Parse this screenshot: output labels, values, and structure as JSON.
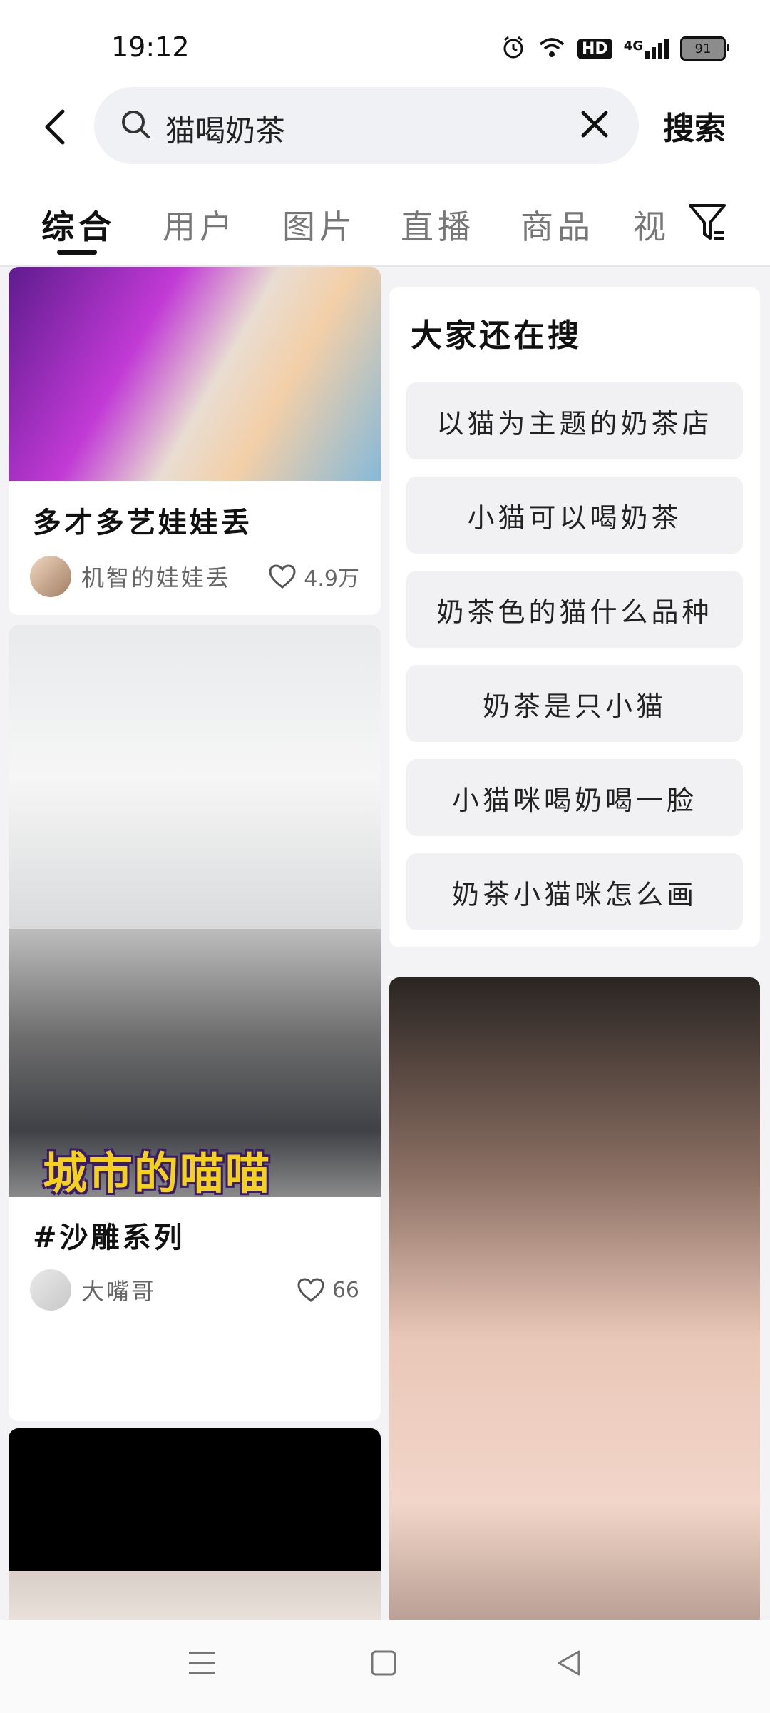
{
  "status_bar": {
    "time": "19:12",
    "hd": "HD",
    "network": "4G",
    "battery": "91"
  },
  "search": {
    "query": "猫喝奶茶",
    "submit_label": "搜索"
  },
  "tabs": [
    {
      "label": "综合",
      "active": true
    },
    {
      "label": "用户",
      "active": false
    },
    {
      "label": "图片",
      "active": false
    },
    {
      "label": "直播",
      "active": false
    },
    {
      "label": "商品",
      "active": false
    },
    {
      "label": "视",
      "active": false
    }
  ],
  "feed": {
    "left": [
      {
        "title": "多才多艺娃娃丢",
        "author": "机智的娃娃丢",
        "likes": "4.9万"
      },
      {
        "overlay_text": "城市的喵喵",
        "title": "#沙雕系列",
        "author": "大嘴哥",
        "likes": "66"
      }
    ],
    "related": {
      "title": "大家还在搜",
      "items": [
        "以猫为主题的奶茶店",
        "小猫可以喝奶茶",
        "奶茶色的猫什么品种",
        "奶茶是只小猫",
        "小猫咪喝奶喝一脸",
        "奶茶小猫咪怎么画"
      ]
    }
  },
  "colors": {
    "accent": "#111111",
    "background": "#f3f3f5",
    "chip": "#f1f1f3",
    "overlay_yellow": "#f4d21a"
  }
}
